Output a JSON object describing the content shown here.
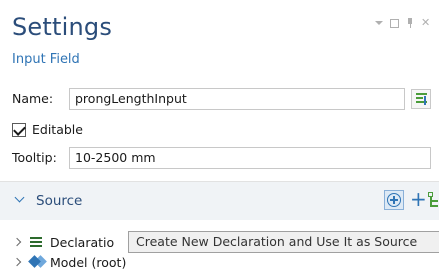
{
  "panel": {
    "title": "Settings",
    "subtitle": "Input Field"
  },
  "form": {
    "name_label": "Name:",
    "name_value": "prongLengthInput",
    "editable_label": "Editable",
    "editable_checked": true,
    "tooltip_label": "Tooltip:",
    "tooltip_value": "10-2500 mm"
  },
  "source": {
    "title": "Source",
    "toolbar": {
      "create_declaration_icon": "add-circle-icon",
      "add_icon": "plus-icon",
      "tree_icon": "tree-icon"
    },
    "tree": [
      {
        "label": "Declaratio",
        "icon": "declarations-icon"
      },
      {
        "label": "Model (root)",
        "icon": "model-icon"
      }
    ]
  },
  "tooltip_popup": {
    "text": "Create New Declaration and Use It as Source"
  },
  "colors": {
    "title": "#2b4d7a",
    "accent": "#2f74b5",
    "section_bg": "#f0f3f6"
  }
}
